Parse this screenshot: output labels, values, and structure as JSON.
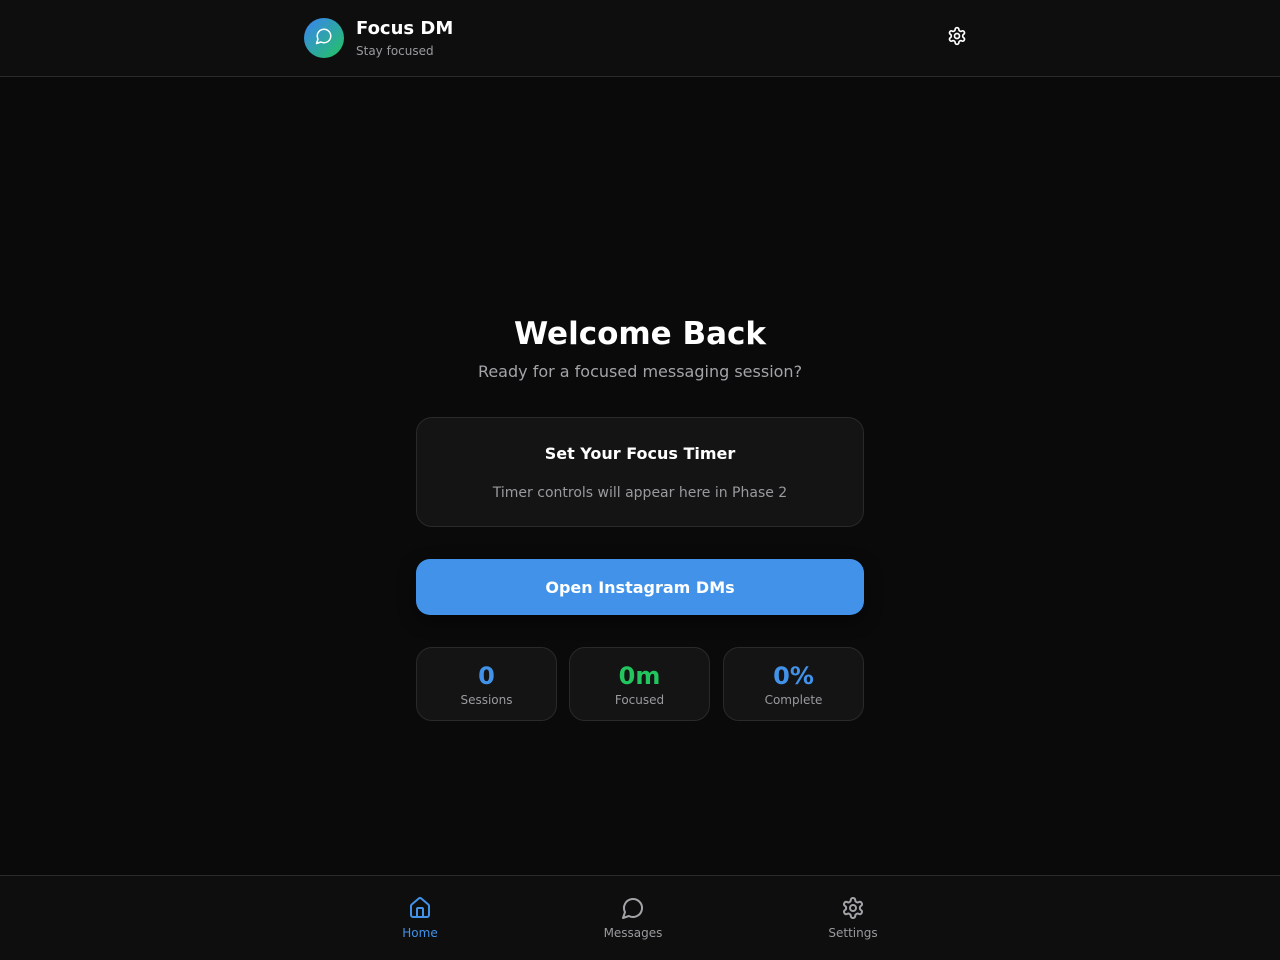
{
  "header": {
    "app_name": "Focus DM",
    "tagline": "Stay focused",
    "logo_icon": "chat-bubble-icon",
    "settings_icon": "gear-icon"
  },
  "welcome": {
    "title": "Welcome Back",
    "subtitle": "Ready for a focused messaging session?"
  },
  "timer_card": {
    "title": "Set Your Focus Timer",
    "note": "Timer controls will appear here in Phase 2"
  },
  "primary_action": {
    "label": "Open Instagram DMs"
  },
  "stats": [
    {
      "value": "0",
      "label": "Sessions",
      "color": "#4192e8"
    },
    {
      "value": "0m",
      "label": "Focused",
      "color": "#22c55e"
    },
    {
      "value": "0%",
      "label": "Complete",
      "color": "#4192e8"
    }
  ],
  "bottom_nav": {
    "active": "Home",
    "items": [
      {
        "label": "Home",
        "icon": "home-icon"
      },
      {
        "label": "Messages",
        "icon": "chat-bubble-icon"
      },
      {
        "label": "Settings",
        "icon": "gear-icon"
      }
    ]
  },
  "colors": {
    "background": "#0a0a0b",
    "accent": "#4192e8",
    "success": "#22c55e",
    "card": "#141415",
    "muted_text": "#9a9a9e"
  }
}
